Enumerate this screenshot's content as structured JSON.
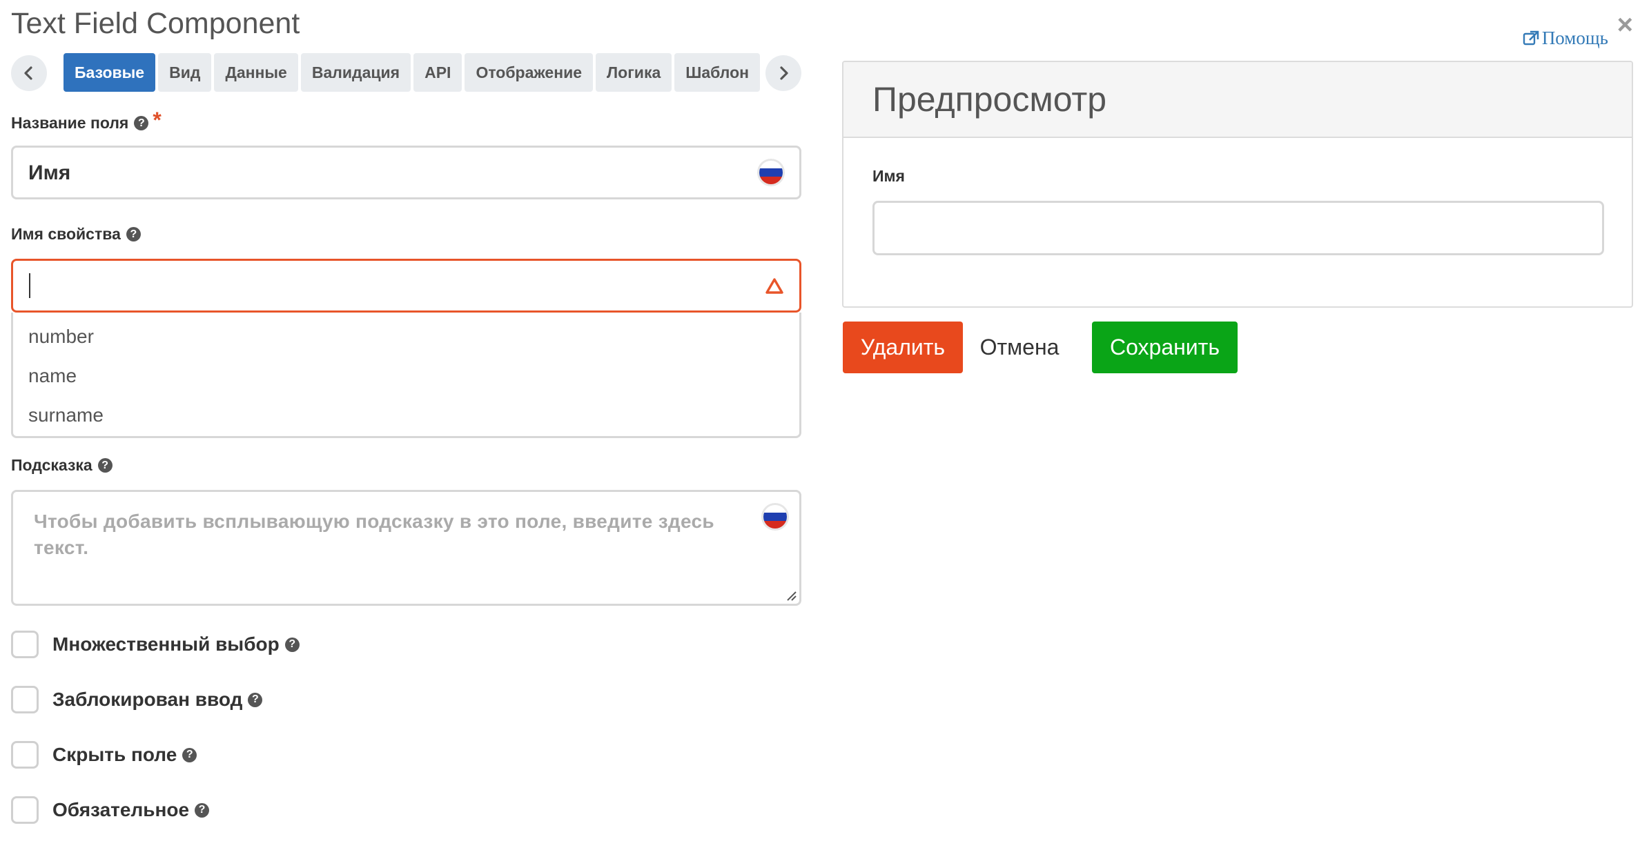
{
  "window": {
    "title": "Text Field Component",
    "help_label": "Помощь",
    "close_label": "×"
  },
  "tabs": [
    {
      "label": "Базовые",
      "active": true
    },
    {
      "label": "Вид"
    },
    {
      "label": "Данные"
    },
    {
      "label": "Валидация"
    },
    {
      "label": "API"
    },
    {
      "label": "Отображение"
    },
    {
      "label": "Логика"
    },
    {
      "label": "Шаблон"
    }
  ],
  "form": {
    "field_name": {
      "label": "Название поля",
      "required_mark": "*",
      "value": "Имя"
    },
    "property_name": {
      "label": "Имя свойства",
      "value": "",
      "suggestions": [
        "number",
        "name",
        "surname"
      ]
    },
    "tooltip": {
      "label": "Подсказка",
      "placeholder": "Чтобы добавить всплывающую подсказку в это поле, введите здесь текст."
    },
    "checkboxes": [
      {
        "label": "Множественный выбор",
        "checked": false
      },
      {
        "label": "Заблокирован ввод",
        "checked": false
      },
      {
        "label": "Скрыть поле",
        "checked": false
      },
      {
        "label": "Обязательное",
        "checked": false
      }
    ]
  },
  "preview": {
    "title": "Предпросмотр",
    "field_label": "Имя",
    "field_value": ""
  },
  "actions": {
    "delete_label": "Удалить",
    "cancel_label": "Отмена",
    "save_label": "Сохранить"
  },
  "icons": {
    "help_link": "external-link-icon",
    "question": "question-circle-icon",
    "flag": "russian-flag-icon",
    "warning": "warning-triangle-icon",
    "nav_left": "chevron-left-icon",
    "nav_right": "chevron-right-icon"
  },
  "colors": {
    "accent_blue": "#2f72bd",
    "error_orange": "#e8552a",
    "delete_red": "#e8491d",
    "save_green": "#0aa517",
    "link_blue": "#337ab7"
  }
}
